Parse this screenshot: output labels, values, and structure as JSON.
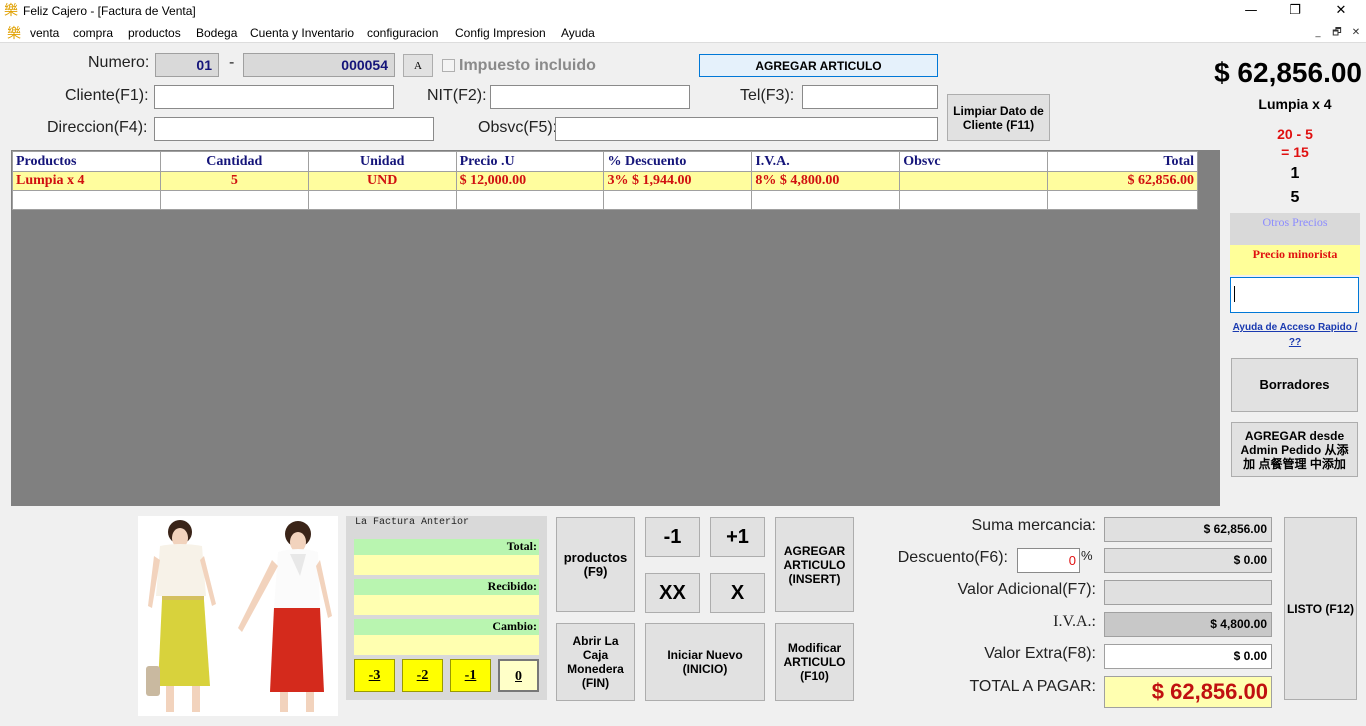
{
  "window": {
    "title": "Feliz Cajero - [Factura de Venta]",
    "app_icon": "樂",
    "minimize": "—",
    "maximize": "❐",
    "close": "✕"
  },
  "menu": {
    "icon": "樂",
    "items": [
      "venta",
      "compra",
      "productos",
      "Bodega",
      "Cuenta y Inventario",
      "configuracion",
      "Config Impresion",
      "Ayuda"
    ],
    "mdi_min": "_",
    "mdi_restore": "🗗",
    "mdi_close": "✕"
  },
  "form": {
    "numero_label": "Numero:",
    "numero_prefix": "01",
    "numero_dash": "-",
    "numero_value": "000054",
    "a_button": "A",
    "impuesto_label": "Impuesto incluido",
    "agregar_articulo": "AGREGAR ARTICULO",
    "cliente_label": "Cliente(F1):",
    "nit_label": "NIT(F2):",
    "tel_label": "Tel(F3):",
    "direccion_label": "Direccion(F4):",
    "obsvc_label": "Obsvc(F5):",
    "limpiar_button": "Limpiar Dato de Cliente (F11)"
  },
  "grid": {
    "columns": [
      "Productos",
      "Cantidad",
      "Unidad",
      "Precio .U",
      "% Descuento",
      "I.V.A.",
      "Obsvc",
      "Total"
    ],
    "rows": [
      [
        "Lumpia x 4",
        "5",
        "UND",
        "$ 12,000.00",
        "3% $ 1,944.00",
        "8% $ 4,800.00",
        "",
        "$ 62,856.00"
      ]
    ]
  },
  "side": {
    "big_total": "$ 62,856.00",
    "product_name": "Lumpia x 4",
    "calc_line1": "20 - 5",
    "calc_line2": "= 15",
    "num1": "1",
    "num2": "5",
    "otros_precios": "Otros Precios",
    "precio_minorista": "Precio minorista",
    "ayuda_link": "Ayuda de Acceso Rapido / ??",
    "borradores": "Borradores",
    "agregar_admin": "AGREGAR desde Admin Pedido 从添加 点餐管理 中添加"
  },
  "factura_anterior": {
    "title": "La Factura Anterior",
    "total": "Total:",
    "recibido": "Recibido:",
    "cambio": "Cambio:",
    "buttons": [
      "-3",
      "-2",
      "-1",
      "0"
    ]
  },
  "actions": {
    "productos": "productos (F9)",
    "minus1": "-1",
    "plus1": "+1",
    "xx": "XX",
    "x": "X",
    "agregar_insert": "AGREGAR ARTICULO (INSERT)",
    "abrir_caja": "Abrir La Caja Monedera (FIN)",
    "iniciar_nuevo": "Iniciar Nuevo (INICIO)",
    "modificar": "Modificar ARTICULO (F10)"
  },
  "summary": {
    "suma_label": "Suma mercancia:",
    "suma_value": "$ 62,856.00",
    "descuento_label": "Descuento(F6):",
    "descuento_input": "0",
    "descuento_pct": "%",
    "descuento_value": "$ 0.00",
    "valor_adicional_label": "Valor Adicional(F7):",
    "valor_adicional_value": "",
    "iva_label": "I.V.A.:",
    "iva_value": "$ 4,800.00",
    "valor_extra_label": "Valor Extra(F8):",
    "valor_extra_value": "$ 0.00",
    "total_label": "TOTAL A PAGAR:",
    "total_value": "$ 62,856.00",
    "listo": "LISTO (F12)"
  }
}
